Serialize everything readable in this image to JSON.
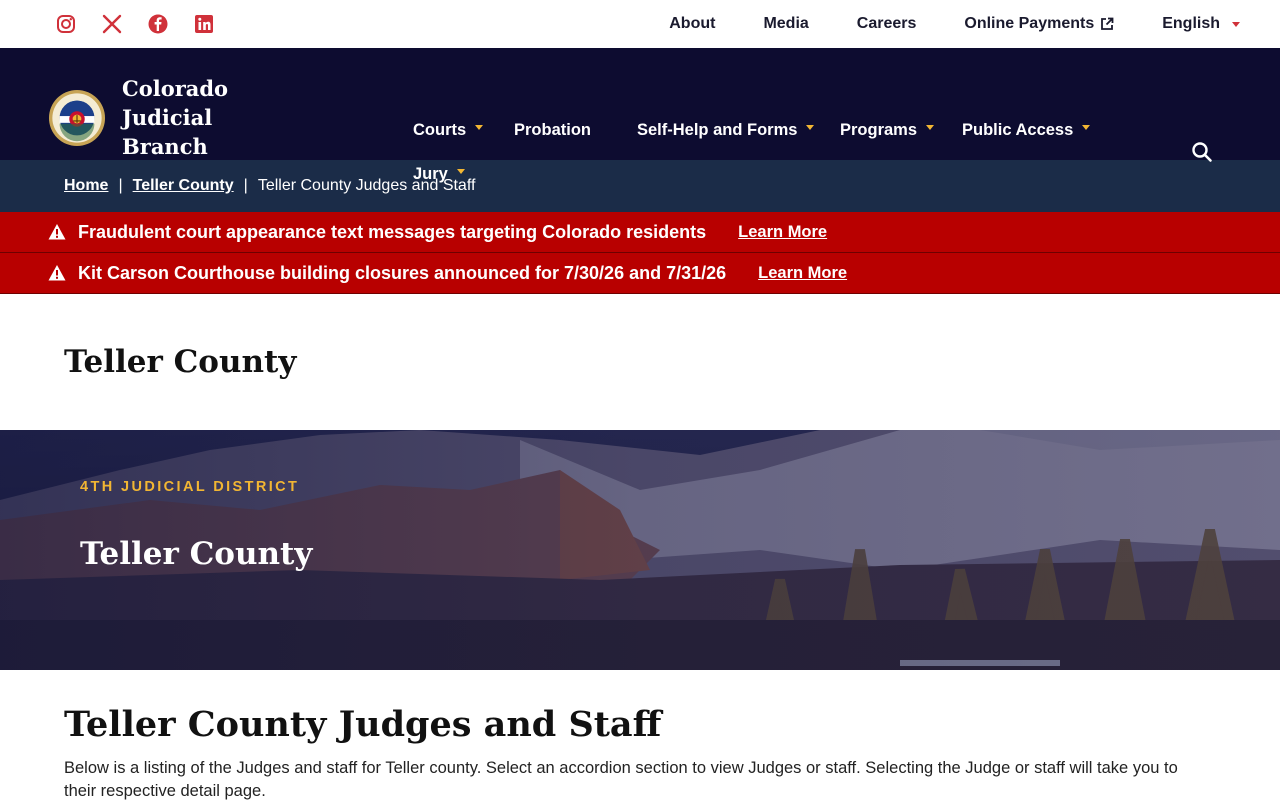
{
  "utility": {
    "social_icons": [
      "instagram-icon",
      "x-icon",
      "facebook-icon",
      "linkedin-icon"
    ],
    "links": {
      "about": "About",
      "media": "Media",
      "careers": "Careers",
      "online_payments": "Online Payments",
      "language": "English"
    }
  },
  "brand": {
    "name_line1": "Colorado Judicial",
    "name_line2": "Branch",
    "seal_icon": "colorado-courts-seal-icon"
  },
  "nav": {
    "courts": "Courts",
    "probation": "Probation",
    "self_help": "Self-Help and Forms",
    "programs": "Programs",
    "public_access": "Public Access",
    "jury": "Jury"
  },
  "breadcrumb": {
    "home": "Home",
    "county": "Teller County",
    "current": "Teller County Judges and Staff"
  },
  "alerts": [
    {
      "message": "Fraudulent court appearance text messages targeting Colorado residents",
      "link": "Learn More"
    },
    {
      "message": "Kit Carson Courthouse building closures announced for 7/30/26 and 7/31/26",
      "link": "Learn More"
    }
  ],
  "page_title": "Teller County",
  "hero": {
    "eyebrow": "4TH JUDICIAL DISTRICT",
    "title": "Teller County"
  },
  "content": {
    "heading": "Teller County Judges and Staff",
    "intro": "Below is a listing of the Judges and staff for Teller county. Select an accordion section to view Judges or staff. Selecting the Judge or staff will take you to their respective detail page."
  },
  "colors": {
    "nav_bg": "#0d0c30",
    "breadcrumb_bg": "#1b2c48",
    "alert_bg": "#b80000",
    "accent_gold": "#f2b633",
    "social_red": "#d0313a"
  }
}
